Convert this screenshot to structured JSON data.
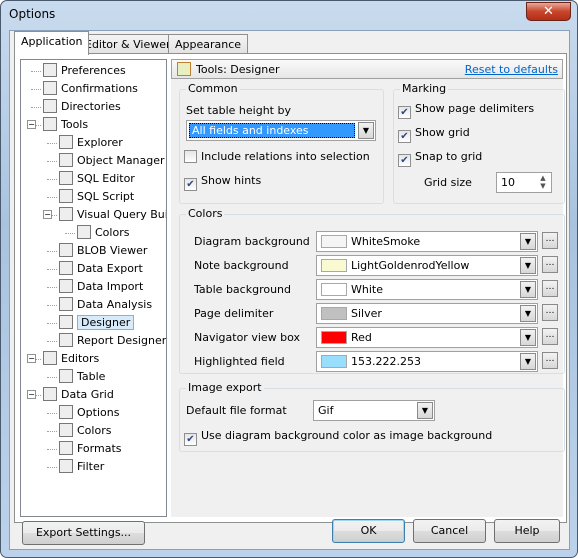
{
  "window": {
    "title": "Options",
    "close": "✕"
  },
  "tabs": [
    {
      "label": "Application",
      "active": true
    },
    {
      "label": "Editor & Viewers"
    },
    {
      "label": "Appearance"
    }
  ],
  "tree": [
    {
      "label": "Preferences",
      "level": 1
    },
    {
      "label": "Confirmations",
      "level": 1
    },
    {
      "label": "Directories",
      "level": 1
    },
    {
      "label": "Tools",
      "level": 1,
      "expanded": true
    },
    {
      "label": "Explorer",
      "level": 2
    },
    {
      "label": "Object Manager",
      "level": 2
    },
    {
      "label": "SQL Editor",
      "level": 2
    },
    {
      "label": "SQL Script",
      "level": 2
    },
    {
      "label": "Visual Query Builder",
      "level": 2,
      "expanded": true
    },
    {
      "label": "Colors",
      "level": 3
    },
    {
      "label": "BLOB Viewer",
      "level": 2
    },
    {
      "label": "Data Export",
      "level": 2
    },
    {
      "label": "Data Import",
      "level": 2
    },
    {
      "label": "Data Analysis",
      "level": 2
    },
    {
      "label": "Designer",
      "level": 2,
      "selected": true
    },
    {
      "label": "Report Designer",
      "level": 2
    },
    {
      "label": "Editors",
      "level": 1,
      "expanded": true
    },
    {
      "label": "Table",
      "level": 2
    },
    {
      "label": "Data Grid",
      "level": 1,
      "expanded": true
    },
    {
      "label": "Options",
      "level": 2
    },
    {
      "label": "Colors",
      "level": 2
    },
    {
      "label": "Formats",
      "level": 2
    },
    {
      "label": "Filter",
      "level": 2
    }
  ],
  "panel": {
    "title": "Tools: Designer",
    "reset": "Reset to defaults"
  },
  "common": {
    "title": "Common",
    "height_label": "Set table height by",
    "height_value": "All fields and indexes",
    "include_relations": {
      "label": "Include relations into selection",
      "checked": false
    },
    "show_hints": {
      "label": "Show hints",
      "checked": true
    }
  },
  "marking": {
    "title": "Marking",
    "page_delimiters": {
      "label": "Show page delimiters",
      "checked": true
    },
    "show_grid": {
      "label": "Show grid",
      "checked": true
    },
    "snap": {
      "label": "Snap to grid",
      "checked": true
    },
    "grid_size_label": "Grid size",
    "grid_size": "10"
  },
  "colors": {
    "title": "Colors",
    "items": [
      {
        "label": "Diagram background",
        "value": "WhiteSmoke",
        "color": "#f5f5f5"
      },
      {
        "label": "Note background",
        "value": "LightGoldenrodYellow",
        "color": "#fafad2"
      },
      {
        "label": "Table background",
        "value": "White",
        "color": "#ffffff"
      },
      {
        "label": "Page delimiter",
        "value": "Silver",
        "color": "#c0c0c0"
      },
      {
        "label": "Navigator view box",
        "value": "Red",
        "color": "#ff0000"
      },
      {
        "label": "Highlighted field",
        "value": "153.222.253",
        "color": "#99defd"
      }
    ]
  },
  "image_export": {
    "title": "Image export",
    "format_label": "Default file format",
    "format": "Gif",
    "use_bg": {
      "label": "Use diagram background color as image background",
      "checked": true
    }
  },
  "buttons": {
    "export": "Export Settings...",
    "ok": "OK",
    "cancel": "Cancel",
    "help": "Help"
  }
}
